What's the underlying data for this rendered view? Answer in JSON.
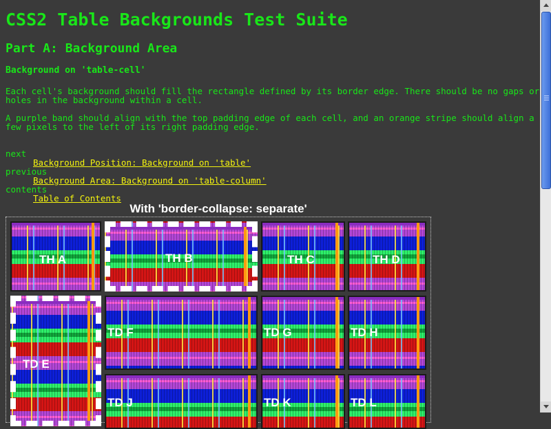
{
  "page": {
    "title": "CSS2 Table Backgrounds Test Suite",
    "subtitle": "Part A: Background Area",
    "section": "Background on 'table-cell'",
    "paragraphs": [
      "Each cell's background should fill the rectangle defined by its border edge. There should be no gaps or holes in the background within a cell.",
      "A purple band should align with the top padding edge of each cell, and an orange stripe should align a few pixels to the left of its right padding edge."
    ]
  },
  "nav": {
    "next_label": "next",
    "next_link": "Background Position: Background on 'table'",
    "previous_label": "previous",
    "previous_link": "Background Area: Background on 'table-column'",
    "contents_label": "contents",
    "contents_link": "Table of Contents"
  },
  "table": {
    "caption": "With 'border-collapse: separate'",
    "cells": {
      "tha": "TH A",
      "thb": "TH B",
      "thc": "TH C",
      "thd": "TH D",
      "tde": "TD E",
      "tdf": "TD F",
      "tdg": "TD G",
      "tdh": "TD H",
      "tdj": "TD J",
      "tdk": "TD K",
      "tdl": "TD L"
    }
  },
  "colors": {
    "background": "#3a3a3a",
    "text": "#19e619",
    "link": "#f4f40e"
  }
}
